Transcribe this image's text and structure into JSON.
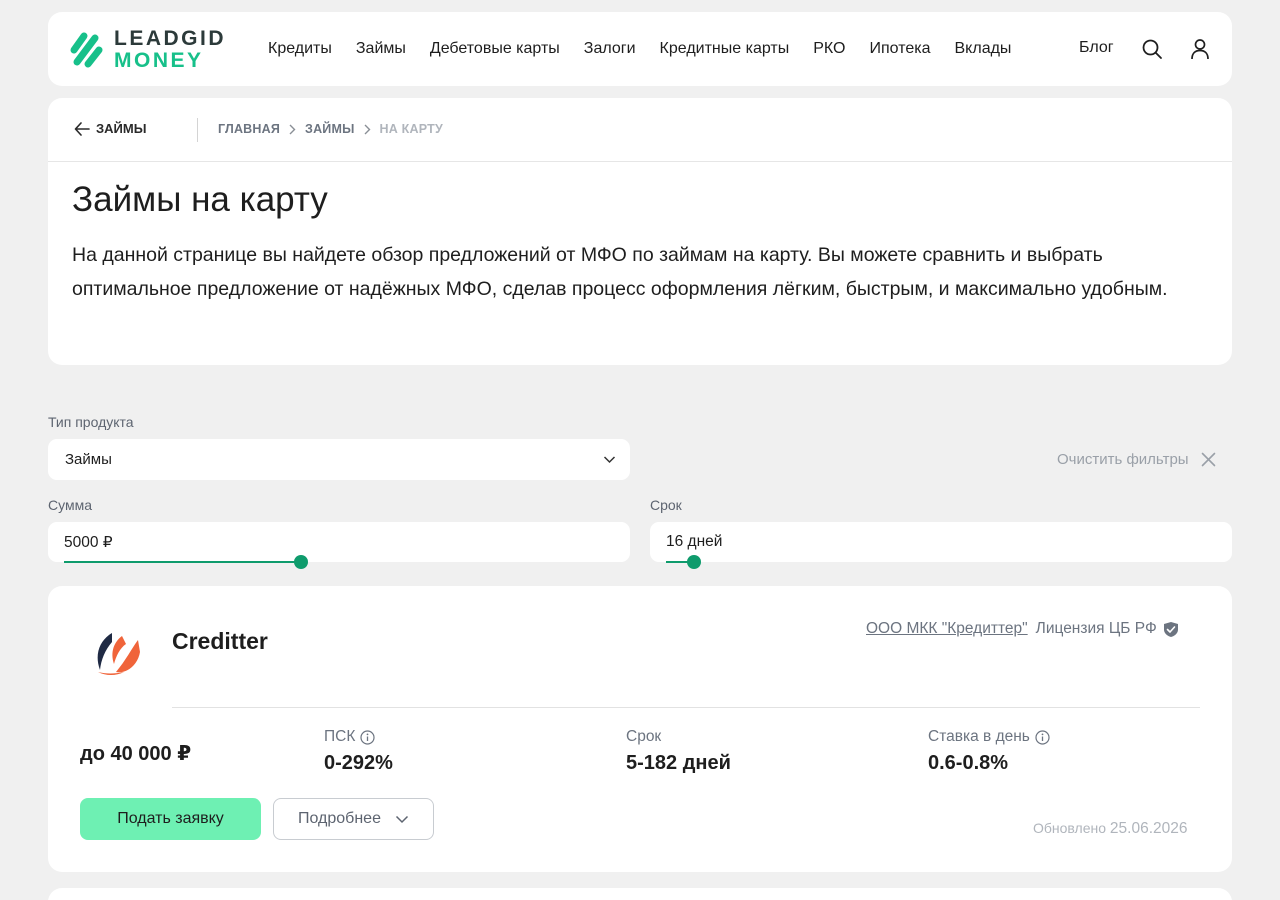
{
  "brand": {
    "line1": "LEADGID",
    "line2": "MONEY"
  },
  "nav": {
    "items": [
      "Кредиты",
      "Займы",
      "Дебетовые карты",
      "Залоги",
      "Кредитные карты",
      "РКО",
      "Ипотека",
      "Вклады"
    ],
    "blog": "Блог"
  },
  "intro": {
    "back_label": "ЗАЙМЫ",
    "breadcrumbs": [
      "ГЛАВНАЯ",
      "ЗАЙМЫ",
      "НА КАРТУ"
    ],
    "title": "Займы на карту",
    "description": "На данной странице вы найдете обзор предложений от МФО по займам на карту. Вы можете сравнить и выбрать оптимальное предложение от надёжных МФО, сделав процесс оформления лёгким, быстрым, и максимально удобным."
  },
  "filters": {
    "product_type_label": "Тип продукта",
    "product_type_value": "Займы",
    "clear_label": "Очистить фильтры",
    "sum_label": "Сумма",
    "sum_value": "5000 ₽",
    "sum_fraction": 0.43,
    "term_label": "Срок",
    "term_value": "16 дней",
    "term_fraction": 0.05
  },
  "offer": {
    "name": "Creditter",
    "org": "ООО МКК \"Кредиттер\"",
    "license": "Лицензия ЦБ РФ",
    "amount": "до 40 000 ₽",
    "psk_label": "ПСК",
    "psk_value": "0-292%",
    "term_label": "Срок",
    "term_value": "5-182 дней",
    "rate_label": "Ставка в день",
    "rate_value": "0.6-0.8%",
    "apply_label": "Подать заявку",
    "more_label": "Подробнее",
    "updated_label": "Обновлено",
    "updated_date": "25.06.2026"
  },
  "colors": {
    "accent": "#0e9b6c",
    "button": "#6ef0b3",
    "logo": "#17c08a"
  }
}
